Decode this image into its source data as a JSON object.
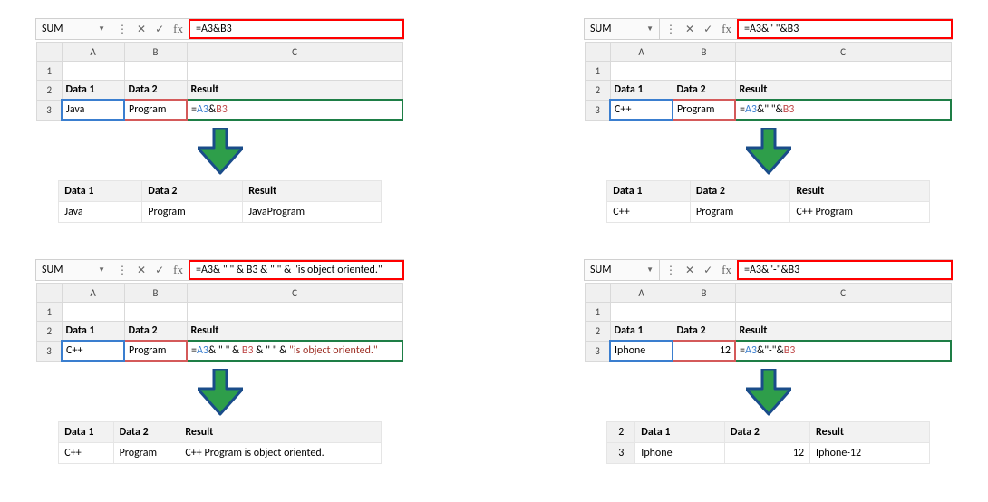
{
  "common": {
    "namebox": "SUM",
    "headers": {
      "a": "Data 1",
      "b": "Data 2",
      "c": "Result"
    },
    "cols": {
      "a": "A",
      "b": "B",
      "c": "C"
    },
    "rows": {
      "r1": "1",
      "r2": "2",
      "r3": "3"
    }
  },
  "p1": {
    "formula": "=A3&B3",
    "a3": "Java",
    "b3": "Program",
    "c3_eq": "=",
    "c3_a": "A3",
    "c3_op": "&",
    "c3_b": "B3",
    "res_a": "Java",
    "res_b": "Program",
    "res_c": "JavaProgram"
  },
  "p2": {
    "formula": "=A3&\" \"&B3",
    "a3": "C++",
    "b3": "Program",
    "c3_eq": "=",
    "c3_a": "A3",
    "c3_mid": "&\" \"&",
    "c3_b": "B3",
    "res_a": "C++",
    "res_b": "Program",
    "res_c": "C++ Program"
  },
  "p3": {
    "formula": "=A3& \" \" & B3 & \" \" & \"is object oriented.\"",
    "a3": "C++",
    "b3": "Program",
    "c3_eq": "=",
    "c3_a": "A3",
    "c3_m1": "& \" \" & ",
    "c3_b": "B3",
    "c3_m2": " & \" \" & ",
    "c3_s": "\"is object oriented.\"",
    "res_a": "C++",
    "res_b": "Program",
    "res_c": "C++  Program is object oriented."
  },
  "p4": {
    "formula": "=A3&\"-\"&B3",
    "a3": "Iphone",
    "b3": "12",
    "c3_eq": "=",
    "c3_a": "A3",
    "c3_mid": "&\"-\"&",
    "c3_b": "B3",
    "res_r2": "2",
    "res_r3": "3",
    "res_a": "Iphone",
    "res_b": "12",
    "res_c": "Iphone-12"
  }
}
